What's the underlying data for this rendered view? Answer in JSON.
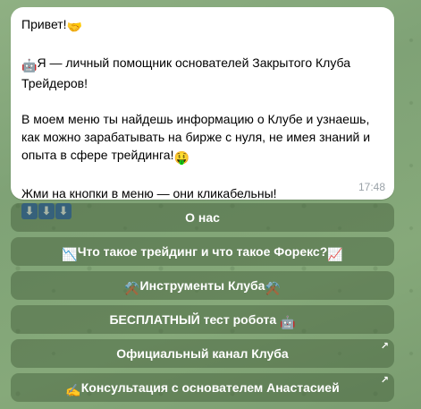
{
  "message": {
    "greeting": "Привет!",
    "intro": "Я — личный помощник основателей Закрытого Клуба Трейдеров!",
    "menu_info": "В моем меню ты найдешь информацию о Клубе и узнаешь, как можно зарабатывать на бирже с нуля, не имея знаний и опыта в сфере трейдинга!",
    "call_to_action": "Жми на кнопки в меню — они кликабельны!",
    "time": "17:48"
  },
  "buttons": [
    {
      "label": "О нас"
    },
    {
      "label": "Что такое трейдинг и что такое Форекс?"
    },
    {
      "label": "Инструменты Клуба"
    },
    {
      "label": "БЕСПЛАТНЫЙ тест робота"
    },
    {
      "label": "Официальный канал Клуба"
    },
    {
      "label": "Консультация с основателем Анастасией"
    }
  ],
  "colors": {
    "bubble": "#ffffff",
    "button_bg": "rgba(64,92,56,0.45)",
    "keycap": "#2f66b3"
  }
}
